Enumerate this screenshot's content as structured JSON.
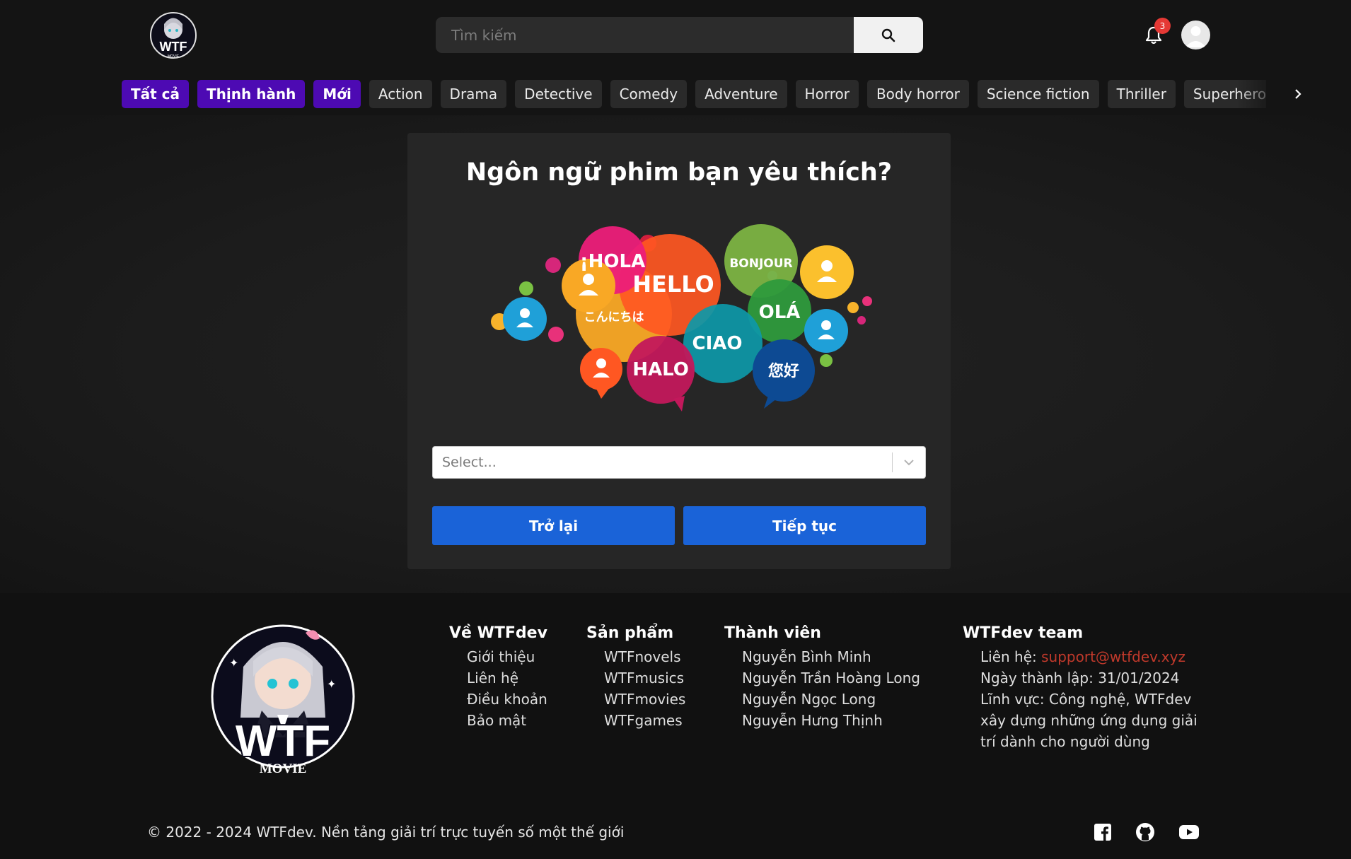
{
  "header": {
    "logo_icon": "wtf-movie-logo",
    "search": {
      "placeholder": "Tìm kiếm",
      "value": "",
      "icon": "search-icon"
    },
    "notifications": {
      "icon": "bell-icon",
      "count": "3"
    },
    "avatar_icon": "user-avatar"
  },
  "genres": [
    {
      "label": "Tất cả",
      "active": true
    },
    {
      "label": "Thịnh hành",
      "active": true
    },
    {
      "label": "Mới",
      "active": true
    },
    {
      "label": "Action",
      "active": false
    },
    {
      "label": "Drama",
      "active": false
    },
    {
      "label": "Detective",
      "active": false
    },
    {
      "label": "Comedy",
      "active": false
    },
    {
      "label": "Adventure",
      "active": false
    },
    {
      "label": "Horror",
      "active": false
    },
    {
      "label": "Body horror",
      "active": false
    },
    {
      "label": "Science fiction",
      "active": false
    },
    {
      "label": "Thriller",
      "active": false
    },
    {
      "label": "Superhero",
      "active": false
    }
  ],
  "card": {
    "title": "Ngôn ngữ phim bạn yêu thích?",
    "bubbles": [
      "¡HOLA",
      "HELLO",
      "BONJOUR",
      "こんにちは",
      "OLÁ",
      "CIAO",
      "HALO",
      "您好"
    ],
    "select": {
      "placeholder": "Select...",
      "value": ""
    },
    "back_label": "Trở lại",
    "next_label": "Tiếp tục"
  },
  "footer": {
    "logo_text": "WTF",
    "logo_sub": "MOVIE",
    "col1": {
      "title": "Về WTFdev",
      "items": [
        "Giới thiệu",
        "Liên hệ",
        "Điều khoản",
        "Bảo mật"
      ]
    },
    "col2": {
      "title": "Sản phẩm",
      "items": [
        "WTFnovels",
        "WTFmusics",
        "WTFmovies",
        "WTFgames"
      ]
    },
    "col3": {
      "title": "Thành viên",
      "items": [
        "Nguyễn Bình Minh",
        "Nguyễn Trần Hoàng Long",
        "Nguyễn Ngọc Long",
        "Nguyễn Hưng Thịnh"
      ]
    },
    "col4": {
      "title": "WTFdev team",
      "contact_label": "Liên hệ: ",
      "contact_email": "support@wtfdev.xyz",
      "founded": "Ngày thành lập: 31/01/2024",
      "field": "Lĩnh vực: Công nghệ, WTFdev xây dựng những ứng dụng giải trí dành cho người dùng"
    },
    "copyright": "© 2022 - 2024 WTFdev. Nền tảng giải trí trực tuyến số một thế giới",
    "social": [
      "facebook-icon",
      "github-icon",
      "youtube-icon"
    ]
  },
  "colors": {
    "background": "#141414",
    "accent_purple": "#4d0ab3",
    "button_blue": "#1a63d8",
    "email_red": "#c0392b",
    "badge_red": "#e53935"
  }
}
